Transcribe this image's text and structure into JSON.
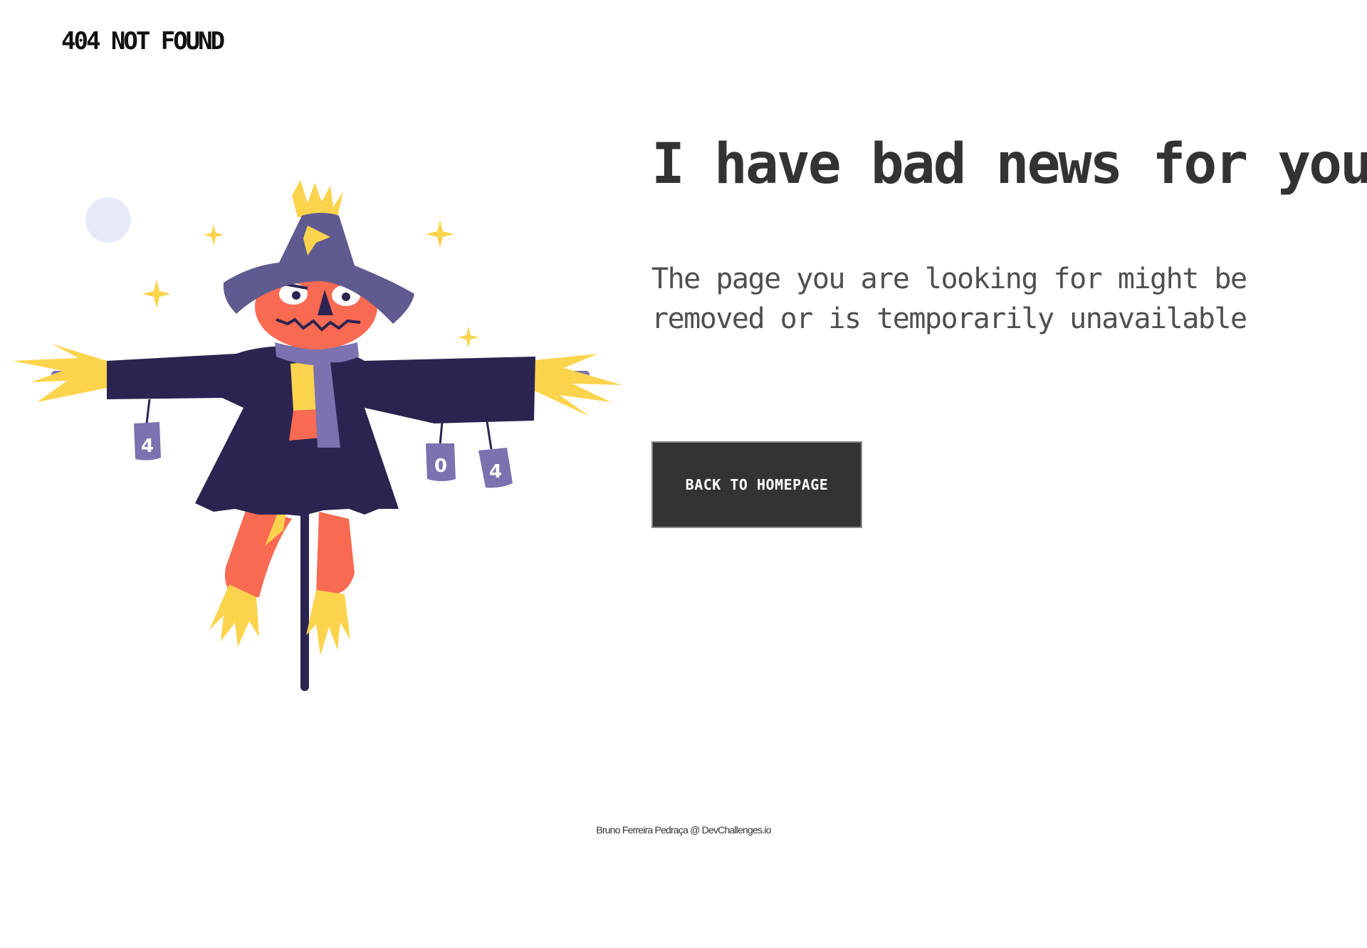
{
  "header": {
    "logo_text": "404 NOT FOUND"
  },
  "illustration": {
    "name": "scarecrow-illustration",
    "can_labels": [
      "4",
      "0",
      "4"
    ]
  },
  "main": {
    "headline": "I have bad news for you",
    "subtext": "The page you are looking for might be removed or is temporarily unavailable",
    "cta_label": "BACK TO HOMEPAGE"
  },
  "footer": {
    "credit": "Bruno Ferreira Pedraça @ DevChallenges.io"
  },
  "colors": {
    "text_dark": "#333333",
    "text_muted": "#4f4f4f",
    "button_bg": "#333333",
    "button_text": "#ffffff",
    "hat_purple": "#5f5a8f",
    "coat_navy": "#2b2450",
    "pumpkin_orange": "#f96a52",
    "straw_yellow": "#fcd34d",
    "moon": "#e7eaf6"
  }
}
